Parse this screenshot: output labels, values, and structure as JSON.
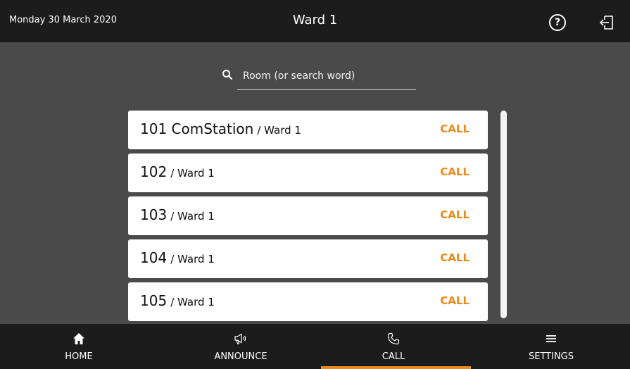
{
  "header": {
    "date": "Monday 30 March 2020",
    "title": "Ward 1",
    "help_icon_label": "?"
  },
  "search": {
    "placeholder": "Room (or search word)",
    "value": ""
  },
  "rooms": [
    {
      "number": "101 ComStation",
      "ward": "/ Ward 1",
      "action": "CALL"
    },
    {
      "number": "102",
      "ward": "/ Ward 1",
      "action": "CALL"
    },
    {
      "number": "103",
      "ward": "/ Ward 1",
      "action": "CALL"
    },
    {
      "number": "104",
      "ward": "/ Ward 1",
      "action": "CALL"
    },
    {
      "number": "105",
      "ward": "/ Ward 1",
      "action": "CALL"
    }
  ],
  "nav": [
    {
      "label": "HOME",
      "icon": "home-icon",
      "active": false
    },
    {
      "label": "ANNOUNCE",
      "icon": "megaphone-icon",
      "active": false
    },
    {
      "label": "CALL",
      "icon": "phone-icon",
      "active": true
    },
    {
      "label": "SETTINGS",
      "icon": "menu-icon",
      "active": false
    }
  ],
  "colors": {
    "accent": "#ee8a1a",
    "bar_background": "#1c1c1c",
    "page_background": "#4a4a4a"
  }
}
